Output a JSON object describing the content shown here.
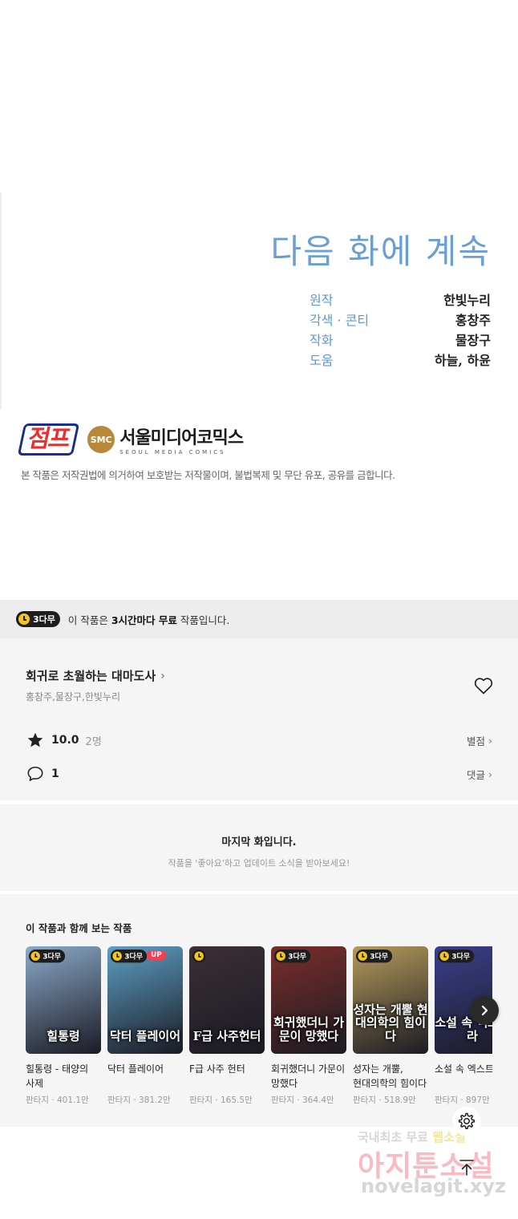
{
  "panel": {
    "continue_title": "다음 화에 계속",
    "credits": [
      {
        "role": "원작",
        "name": "한빛누리"
      },
      {
        "role": "각색 · 콘티",
        "name": "홍창주"
      },
      {
        "role": "작화",
        "name": "물장구"
      },
      {
        "role": "도움",
        "name": "하늘, 하윤"
      }
    ],
    "logo_jump": "점프",
    "logo_smc_emblem": "SMC",
    "logo_smc_name": "서울미디어코믹스",
    "logo_smc_sub": "SEOUL MEDIA COMICS",
    "copyright": "본 작품은 저작권법에 의거하여 보호받는 저작물이며, 불법복제 및 무단 유포, 공유를 금합니다."
  },
  "free_notice": {
    "badge": "3다무",
    "prefix": "이 작품은 ",
    "highlight": "3시간마다 무료",
    "suffix": " 작품입니다."
  },
  "info": {
    "series_title": "회귀로 초월하는 대마도사",
    "authors": "홍창주,물장구,한빛누리",
    "score": "10.0",
    "score_count": "2명",
    "rating_link": "별점",
    "comment_count": "1",
    "comment_link": "댓글"
  },
  "last_episode": {
    "title": "마지막 화입니다.",
    "subtitle": "작품을 '좋아요'하고 업데이트 소식을 받아보세요!"
  },
  "recommendations": {
    "title": "이 작품과 함께 보는 작품",
    "badge": "3다무",
    "up_label": "UP",
    "items": [
      {
        "name": "힐통령 - 태양의 사제",
        "meta": "판타지 · 401.1만",
        "cover_text": "힐통령",
        "bg": "#8aa9c9"
      },
      {
        "name": "닥터 플레이어",
        "meta": "판타지 · 381.2만",
        "cover_text": "닥터 플레이어",
        "bg": "#5d9fc4"
      },
      {
        "name": "F급 사주 헌터",
        "meta": "판타지 · 165.5만",
        "cover_text": "F급 사주헌터",
        "bg": "#3b2f35"
      },
      {
        "name": "회귀했더니 가문이 망했다",
        "meta": "판타지 · 364.4만",
        "cover_text": "회귀했더니 가문이 망했다",
        "bg": "#7a2e2a"
      },
      {
        "name": "성자는 개뿔, 현대의학의 힘이다",
        "meta": "판타지 · 518.9만",
        "cover_text": "성자는 개뿔 현대의학의 힘이다",
        "bg": "#b59a5a"
      },
      {
        "name": "소설 속 엑스트",
        "meta": "판타지 · 897만",
        "cover_text": "소설 속 엑스트라",
        "bg": "#3a3f8a"
      }
    ]
  },
  "watermark": {
    "line1_a": "국내최초 무료",
    "line1_b": "웹소설",
    "line2": "아지툰소설",
    "line3": "novelagit.xyz"
  },
  "colors": {
    "accent_blue": "#6a9fd4",
    "badge_dark": "#1e1e1e",
    "badge_clock": "#f5c518",
    "up_badge": "#ff3a4a"
  },
  "icons": {
    "heart": "heart-outline-icon",
    "star": "star-icon",
    "comment": "speech-bubble-icon",
    "next": "chevron-right-icon",
    "settings": "gear-icon",
    "top": "arrow-up-icon"
  }
}
